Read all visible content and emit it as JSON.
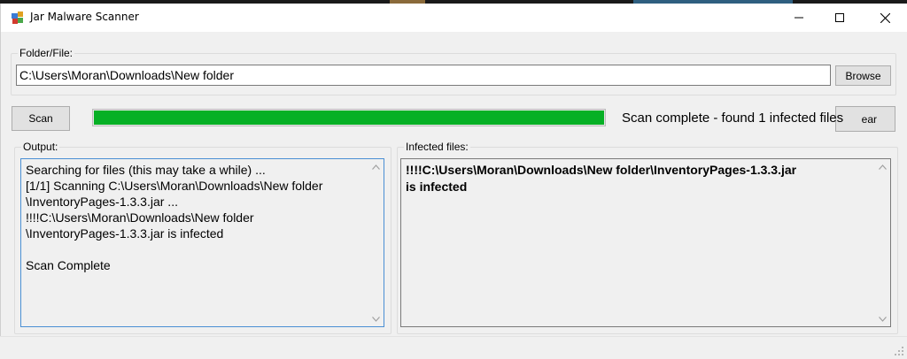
{
  "window": {
    "title": "Jar Malware Scanner"
  },
  "folder": {
    "label": "Folder/File:",
    "path_value": "C:\\Users\\Moran\\Downloads\\New folder",
    "browse_label": "Browse"
  },
  "scan": {
    "scan_label": "Scan",
    "progress_percent": 100,
    "progress_color": "#06b025",
    "status": "Scan complete - found 1 infected files",
    "clear_label": "ear"
  },
  "output": {
    "label": "Output:",
    "text": "Searching for files (this may take a while) ...\n[1/1] Scanning C:\\Users\\Moran\\Downloads\\New folder\n\\InventoryPages-1.3.3.jar ...\n!!!!C:\\Users\\Moran\\Downloads\\New folder\n\\InventoryPages-1.3.3.jar is infected\n\nScan Complete"
  },
  "infected": {
    "label": "Infected files:",
    "text": "!!!!C:\\Users\\Moran\\Downloads\\New folder\\InventoryPages-1.3.3.jar\nis infected"
  },
  "icons": {
    "app": "jar-app-icon",
    "minimize": "minimize-icon",
    "maximize": "maximize-icon",
    "close": "close-icon",
    "scroll_up": "chevron-up-icon",
    "scroll_down": "chevron-down-icon",
    "grip": "resize-grip-icon"
  }
}
